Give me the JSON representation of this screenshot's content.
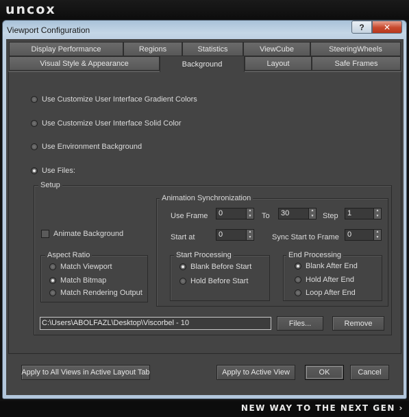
{
  "branding": {
    "logo": "uncox",
    "tagline": "NEW WAY TO THE NEXT GEN ›"
  },
  "window": {
    "title": "Viewport Configuration",
    "help_label": "?",
    "close_label": "✕"
  },
  "tabs_row1": [
    {
      "label": "Display Performance"
    },
    {
      "label": "Regions"
    },
    {
      "label": "Statistics"
    },
    {
      "label": "ViewCube"
    },
    {
      "label": "SteeringWheels"
    }
  ],
  "tabs_row2": [
    {
      "label": "Visual Style & Appearance"
    },
    {
      "label": "Background",
      "active": true
    },
    {
      "label": "Layout"
    },
    {
      "label": "Safe Frames"
    }
  ],
  "background_options": [
    {
      "label": "Use Customize User Interface Gradient Colors",
      "checked": false
    },
    {
      "label": "Use Customize User Interface Solid Color",
      "checked": false
    },
    {
      "label": "Use Environment Background",
      "checked": false
    },
    {
      "label": "Use Files:",
      "checked": true
    }
  ],
  "setup": {
    "title": "Setup",
    "animate_background": {
      "label": "Animate Background",
      "checked": false
    },
    "aspect_ratio": {
      "title": "Aspect Ratio",
      "options": [
        {
          "label": "Match Viewport",
          "checked": false
        },
        {
          "label": "Match Bitmap",
          "checked": true
        },
        {
          "label": "Match Rendering Output",
          "checked": false
        }
      ]
    },
    "animation_sync": {
      "title": "Animation Synchronization",
      "use_frame_label": "Use Frame",
      "use_frame_value": "0",
      "to_label": "To",
      "to_value": "30",
      "step_label": "Step",
      "step_value": "1",
      "start_at_label": "Start at",
      "start_at_value": "0",
      "sync_start_label": "Sync Start to Frame",
      "sync_start_value": "0",
      "start_processing": {
        "title": "Start Processing",
        "options": [
          {
            "label": "Blank Before Start",
            "checked": true
          },
          {
            "label": "Hold Before Start",
            "checked": false
          }
        ]
      },
      "end_processing": {
        "title": "End Processing",
        "options": [
          {
            "label": "Blank After End",
            "checked": true
          },
          {
            "label": "Hold After End",
            "checked": false
          },
          {
            "label": "Loop After End",
            "checked": false
          }
        ]
      }
    },
    "file_path": "C:\\Users\\ABOLFAZL\\Desktop\\Viscorbel - 10",
    "files_button": "Files...",
    "remove_button": "Remove"
  },
  "footer": {
    "apply_all": "Apply to All Views in Active Layout Tab",
    "apply_active": "Apply to Active View",
    "ok": "OK",
    "cancel": "Cancel"
  },
  "spinner_arrows": {
    "up": "▲",
    "down": "▼"
  }
}
